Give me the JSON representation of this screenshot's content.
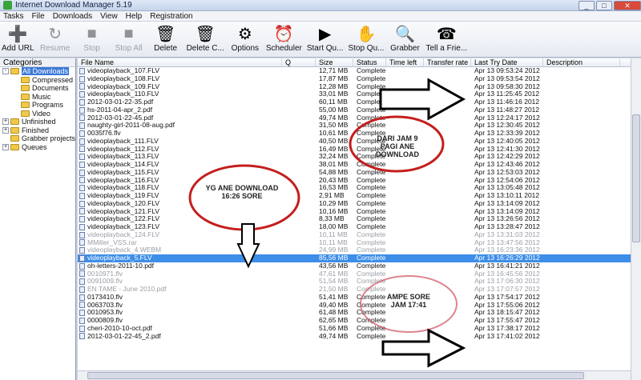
{
  "window": {
    "title": "Internet Download Manager 5.19"
  },
  "menu": [
    "Tasks",
    "File",
    "Downloads",
    "View",
    "Help",
    "Registration"
  ],
  "toolbar": [
    {
      "label": "Add URL",
      "icon": "add-url-icon",
      "glyph": "➕",
      "disabled": false
    },
    {
      "label": "Resume",
      "icon": "resume-icon",
      "glyph": "↻",
      "disabled": true
    },
    {
      "label": "Stop",
      "icon": "stop-icon",
      "glyph": "■",
      "disabled": true
    },
    {
      "label": "Stop All",
      "icon": "stop-all-icon",
      "glyph": "■",
      "disabled": true
    },
    {
      "label": "Delete",
      "icon": "delete-icon",
      "glyph": "🗑",
      "disabled": false
    },
    {
      "label": "Delete C...",
      "icon": "delete-completed-icon",
      "glyph": "🗑",
      "disabled": false
    },
    {
      "label": "Options",
      "icon": "options-gear-icon",
      "glyph": "⚙",
      "disabled": false
    },
    {
      "label": "Scheduler",
      "icon": "scheduler-clock-icon",
      "glyph": "⏰",
      "disabled": false
    },
    {
      "label": "Start Qu...",
      "icon": "start-queue-icon",
      "glyph": "▶",
      "disabled": false
    },
    {
      "label": "Stop Qu...",
      "icon": "stop-queue-icon",
      "glyph": "✋",
      "disabled": false
    },
    {
      "label": "Grabber",
      "icon": "grabber-icon",
      "glyph": "🔍",
      "disabled": false
    },
    {
      "label": "Tell a Frie...",
      "icon": "tell-friend-icon",
      "glyph": "☎",
      "disabled": false
    }
  ],
  "sidebar": {
    "header": "Categories",
    "items": [
      {
        "label": "All Downloads",
        "expander": "-",
        "indent": 0,
        "selected": true
      },
      {
        "label": "Compressed",
        "expander": "",
        "indent": 1,
        "selected": false
      },
      {
        "label": "Documents",
        "expander": "",
        "indent": 1,
        "selected": false
      },
      {
        "label": "Music",
        "expander": "",
        "indent": 1,
        "selected": false
      },
      {
        "label": "Programs",
        "expander": "",
        "indent": 1,
        "selected": false
      },
      {
        "label": "Video",
        "expander": "",
        "indent": 1,
        "selected": false
      },
      {
        "label": "Unfinished",
        "expander": "+",
        "indent": 0,
        "selected": false
      },
      {
        "label": "Finished",
        "expander": "+",
        "indent": 0,
        "selected": false
      },
      {
        "label": "Grabber projects",
        "expander": "",
        "indent": 0,
        "selected": false
      },
      {
        "label": "Queues",
        "expander": "+",
        "indent": 0,
        "selected": false
      }
    ]
  },
  "list": {
    "columns": [
      "File Name",
      "Q",
      "Size",
      "Status",
      "Time left",
      "Transfer rate",
      "Last Try Date",
      "Description"
    ],
    "rows": [
      {
        "name": "videoplayback_107.FLV",
        "size": "12,71 MB",
        "status": "Complete",
        "date": "Apr 13 09:53:24 2012",
        "state": ""
      },
      {
        "name": "videoplayback_108.FLV",
        "size": "17,87 MB",
        "status": "Complete",
        "date": "Apr 13 09:53:54 2012",
        "state": ""
      },
      {
        "name": "videoplayback_109.FLV",
        "size": "12,28 MB",
        "status": "Complete",
        "date": "Apr 13 09:58:30 2012",
        "state": ""
      },
      {
        "name": "videoplayback_110.FLV",
        "size": "33,01 MB",
        "status": "Complete",
        "date": "Apr 13 11:25:45 2012",
        "state": ""
      },
      {
        "name": "2012-03-01-22-35.pdf",
        "size": "60,11 MB",
        "status": "Complete",
        "date": "Apr 13 11:46:16 2012",
        "state": ""
      },
      {
        "name": "hs-2011-04-apr_2.pdf",
        "size": "55,00 MB",
        "status": "Complete",
        "date": "Apr 13 11:48:27 2012",
        "state": ""
      },
      {
        "name": "2012-03-01-22-45.pdf",
        "size": "49,74 MB",
        "status": "Complete",
        "date": "Apr 13 12:24:17 2012",
        "state": ""
      },
      {
        "name": "naughty-girl-2011-08-aug.pdf",
        "size": "31,50 MB",
        "status": "Complete",
        "date": "Apr 13 12:30:45 2012",
        "state": ""
      },
      {
        "name": "0035f76.flv",
        "size": "10,61 MB",
        "status": "Complete",
        "date": "Apr 13 12:33:39 2012",
        "state": ""
      },
      {
        "name": "videoplayback_111.FLV",
        "size": "40,50 MB",
        "status": "Complete",
        "date": "Apr 13 12:40:05 2012",
        "state": ""
      },
      {
        "name": "videoplayback_112.FLV",
        "size": "16,49 MB",
        "status": "Complete",
        "date": "Apr 13 12:41:30 2012",
        "state": ""
      },
      {
        "name": "videoplayback_113.FLV",
        "size": "32,24 MB",
        "status": "Complete",
        "date": "Apr 13 12:42:29 2012",
        "state": ""
      },
      {
        "name": "videoplayback_114.FLV",
        "size": "38,01 MB",
        "status": "Complete",
        "date": "Apr 13 12:43:46 2012",
        "state": ""
      },
      {
        "name": "videoplayback_115.FLV",
        "size": "54,88 MB",
        "status": "Complete",
        "date": "Apr 13 12:53:03 2012",
        "state": ""
      },
      {
        "name": "videoplayback_116.FLV",
        "size": "20,43 MB",
        "status": "Complete",
        "date": "Apr 13 12:54:06 2012",
        "state": ""
      },
      {
        "name": "videoplayback_118.FLV",
        "size": "16,53 MB",
        "status": "Complete",
        "date": "Apr 13 13:05:48 2012",
        "state": ""
      },
      {
        "name": "videoplayback_119.FLV",
        "size": "2,91 MB",
        "status": "Complete",
        "date": "Apr 13 13:10:11 2012",
        "state": ""
      },
      {
        "name": "videoplayback_120.FLV",
        "size": "10,29 MB",
        "status": "Complete",
        "date": "Apr 13 13:14:09 2012",
        "state": ""
      },
      {
        "name": "videoplayback_121.FLV",
        "size": "10,16 MB",
        "status": "Complete",
        "date": "Apr 13 13:14:09 2012",
        "state": ""
      },
      {
        "name": "videoplayback_122.FLV",
        "size": "8,33 MB",
        "status": "Complete",
        "date": "Apr 13 13:26:56 2012",
        "state": ""
      },
      {
        "name": "videoplayback_123.FLV",
        "size": "18,00 MB",
        "status": "Complete",
        "date": "Apr 13 13:28:47 2012",
        "state": ""
      },
      {
        "name": "videoplayback_124.FLV",
        "size": "10,11 MB",
        "status": "Complete",
        "date": "Apr 13 13:31:03 2012",
        "state": "grey"
      },
      {
        "name": "MMiller_VSS.rar",
        "size": "10,11 MB",
        "status": "Complete",
        "date": "Apr 13 13:47:56 2012",
        "state": "grey"
      },
      {
        "name": "videoplayback_4.WEBM",
        "size": "24,99 MB",
        "status": "Complete",
        "date": "Apr 13 16:23:36 2012",
        "state": "grey"
      },
      {
        "name": "videoplayback_5.FLV",
        "size": "85,56 MB",
        "status": "Complete",
        "date": "Apr 13 16:26:29 2012",
        "state": "sel"
      },
      {
        "name": "oh-letters-2011-10.pdf",
        "size": "43,56 MB",
        "status": "Complete",
        "date": "Apr 13 16:41:21 2012",
        "state": ""
      },
      {
        "name": "0010971.flv",
        "size": "47,61 MB",
        "status": "Complete",
        "date": "Apr 13 16:45:56 2012",
        "state": "grey"
      },
      {
        "name": "0091009.flv",
        "size": "51,54 MB",
        "status": "Complete",
        "date": "Apr 13 17:06:30 2012",
        "state": "grey"
      },
      {
        "name": "EN TAME - June 2010.pdf",
        "size": "21,50 MB",
        "status": "Complete",
        "date": "Apr 13 17:07:57 2012",
        "state": "grey"
      },
      {
        "name": "0173410.flv",
        "size": "51,41 MB",
        "status": "Complete",
        "date": "Apr 13 17:54:17 2012",
        "state": ""
      },
      {
        "name": "0063703.flv",
        "size": "49,40 MB",
        "status": "Complete",
        "date": "Apr 13 17:55:06 2012",
        "state": ""
      },
      {
        "name": "0010953.flv",
        "size": "61,48 MB",
        "status": "Complete",
        "date": "Apr 13 18:15:47 2012",
        "state": ""
      },
      {
        "name": "0000809.flv",
        "size": "62,65 MB",
        "status": "Complete",
        "date": "Apr 13 17:55:47 2012",
        "state": ""
      },
      {
        "name": "cheri-2010-10-oct.pdf",
        "size": "51,66 MB",
        "status": "Complete",
        "date": "Apr 13 17:38:17 2012",
        "state": ""
      },
      {
        "name": "2012-03-01-22-45_2.pdf",
        "size": "49,74 MB",
        "status": "Complete",
        "date": "Apr 13 17:41:02 2012",
        "state": ""
      }
    ]
  },
  "annotations": {
    "dari_jam": "DARI JAM 9",
    "dari_jam2": "PAGI ANE DOWNLOAD",
    "yg_ane": "YG ANE DOWNLOAD",
    "yg_ane2": "16:26 SORE",
    "ampe": "AMPE SORE",
    "ampe2": "JAM 17:41",
    "accent_red": "#c41e1e"
  }
}
